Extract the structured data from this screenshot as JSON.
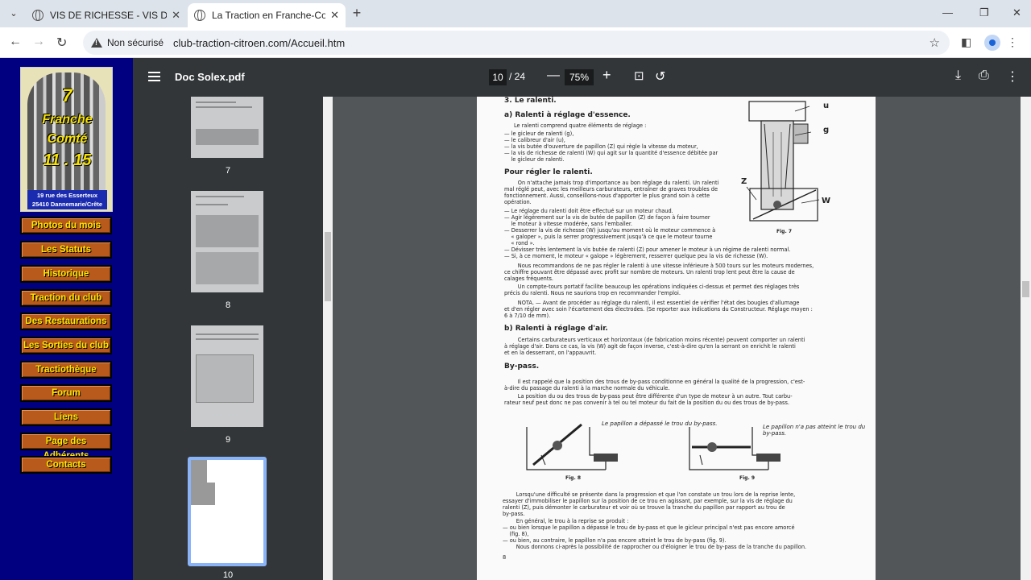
{
  "browser": {
    "tabs": [
      {
        "title": "VIS DE RICHESSE - VIS DE REGLA"
      },
      {
        "title": "La Traction en Franche-Comté"
      }
    ],
    "security_label": "Non sécurisé",
    "url": "club-traction-citroen.com/Accueil.htm"
  },
  "site": {
    "logo": {
      "line1": "7",
      "line2": "Franche",
      "line3": "Comté",
      "line4": "11 . 15",
      "address1": "19 rue des Esserteux",
      "address2": "25410 Dannemarie/Crête"
    },
    "menu": [
      "Photos du mois",
      "Les Statuts",
      "Historique",
      "Traction du club",
      "Des Restaurations",
      "Les Sorties du club",
      "Tractiothèque",
      "Forum",
      "Liens",
      "Page des Adhérents",
      "Contacts"
    ]
  },
  "pdf": {
    "filename": "Doc Solex.pdf",
    "current_page": "10",
    "total_pages": "/ 24",
    "zoom": "75%",
    "thumbnails": [
      "7",
      "8",
      "9",
      "10"
    ]
  },
  "doc": {
    "s3": "3. Le ralenti.",
    "sa": "a) Ralenti à réglage d'essence.",
    "intro": "Le ralenti comprend quatre éléments de réglage :",
    "list1": "— le gicleur de ralenti (g),\n— le calibreur d'air (u),\n— la vis butée d'ouverture de papillon (Z) qui règle la vitesse du moteur,\n— la vis de richesse de ralenti (W) qui agit sur la quantité d'essence débitée par\n    le gicleur de ralenti.",
    "h_regler": "Pour régler le ralenti.",
    "p_regler": "        On n'attache jamais trop d'importance au bon réglage du ralenti. Un ralenti\nmal réglé peut, avec les meilleurs carburateurs, entraîner de graves troubles de\nfonctionnement. Aussi, conseillons-nous d'apporter le plus grand soin à cette\nopération.",
    "list2": "— Le réglage du ralenti doit être effectué sur un moteur chaud.\n— Agir légèrement sur la vis de butée de papillon (Z) de façon à faire tourner\n    le moteur à vitesse modérée, sans l'emballer.\n— Desserrer la vis de richesse (W) jusqu'au moment où le moteur commence à\n    « galoper », puis la serrer progressivement jusqu'à ce que le moteur tourne\n    « rond ».\n— Dévisser très lentement la vis butée de ralenti (Z) pour amener le moteur à un régime de ralenti normal.\n— Si, à ce moment, le moteur « galope » légèrement, resserrer quelque peu la vis de richesse (W).",
    "p_recommend": "        Nous recommandons de ne pas régler le ralenti à une vitesse inférieure à 500 tours sur les moteurs modernes,\nce chiffre pouvant être dépassé avec profit sur nombre de moteurs. Un ralenti trop lent peut être la cause de\ncalages fréquents.",
    "p_compte": "        Un compte-tours portatif facilite beaucoup les opérations indiquées ci-dessus et permet des réglages très\nprécis du ralenti. Nous ne saurions trop en recommander l'emploi.",
    "p_nota": "        NOTA. — Avant de procéder au réglage du ralenti, il est essentiel de vérifier l'état des bougies d'allumage\net d'en régler avec soin l'écartement des électrodes. (Se reporter aux indications du Constructeur. Réglage moyen :\n6 à 7/10 de mm).",
    "sb": "b) Ralenti à réglage d'air.",
    "p_air": "        Certains carburateurs verticaux et horizontaux (de fabrication moins récente) peuvent comporter un ralenti\nà réglage d'air. Dans ce cas, la vis (W) agit de façon inverse, c'est-à-dire qu'en la serrant on enrichit le ralenti\net en la desserrant, on l'appauvrit.",
    "h_bypass": "By-pass.",
    "p_bypass1": "        Il est rappelé que la position des trous de by-pass conditionne en général la qualité de la progression, c'est-\nà-dire du passage du ralenti à la marche normale du véhicule.",
    "p_bypass2": "        La position du ou des trous de by-pass peut être différente d'un type de moteur à un autre. Tout carbu-\nrateur neuf peut donc ne pas convenir à tel ou tel moteur du fait de la position du ou des trous de by-pass.",
    "fig8_note": "Le papillon a\ndépassé le trou\ndu by-pass.",
    "fig9_note": "Le papillon n'a\npas atteint le\ntrou du by-pass.",
    "fig7": "Fig. 7",
    "fig8": "Fig. 8",
    "fig9": "Fig. 9",
    "fig7_labels": {
      "u": "u",
      "g": "g",
      "z": "Z",
      "w": "W"
    },
    "p_diff": "        Lorsqu'une difficulté se présente dans la progression et que l'on constate un trou lors de la reprise lente,\nessayer d'immobiliser le papillon sur la position de ce trou en agissant, par exemple, sur la vis de réglage du\nralenti (Z), puis démonter le carburateur et voir où se trouve la tranche du papillon par rapport au trou de\nby-pass.",
    "p_general": "        En général, le trou à la reprise se produit :\n— ou bien lorsque le papillon a dépassé le trou de by-pass et que le gicleur principal n'est pas encore amorcé\n    (fig. 8),\n— ou bien, au contraire, le papillon n'a pas encore atteint le trou de by-pass (fig. 9).\n        Nous donnons ci-après la possibilité de rapprocher ou d'éloigner le trou de by-pass de la tranche du papillon.",
    "page_no": "8"
  }
}
